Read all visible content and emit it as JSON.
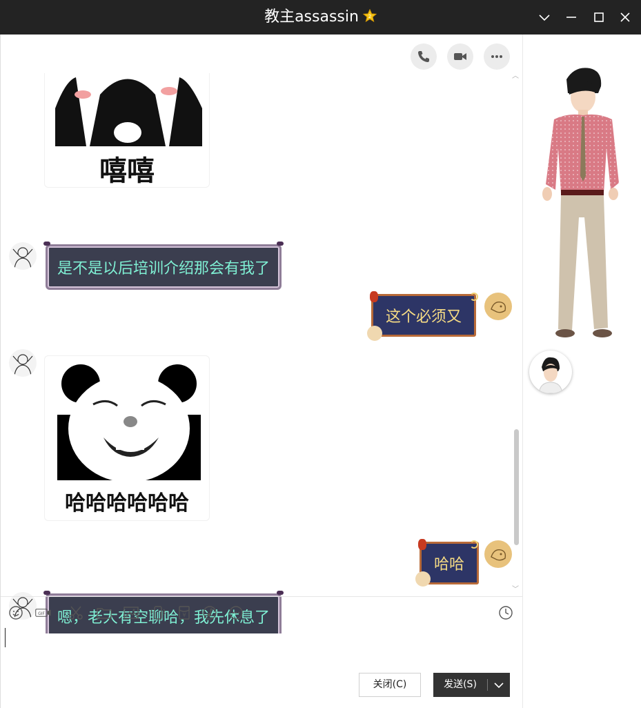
{
  "window": {
    "title": "教主assassin",
    "controls": [
      "chevron-down",
      "minimize",
      "maximize",
      "close"
    ]
  },
  "header_actions": [
    "phone",
    "video",
    "more"
  ],
  "messages": [
    {
      "type": "sticker",
      "side": "in",
      "caption": "嘻嘻"
    },
    {
      "type": "text",
      "side": "in",
      "text": "是不是以后培训介绍那会有我了"
    },
    {
      "type": "text",
      "side": "out",
      "text": "这个必须又"
    },
    {
      "type": "sticker",
      "side": "in",
      "caption": "哈哈哈哈哈哈"
    },
    {
      "type": "text",
      "side": "out",
      "text": "哈哈"
    },
    {
      "type": "text",
      "side": "in",
      "text": "嗯，老大有空聊哈，我先休息了"
    }
  ],
  "toolbar": [
    "emoji",
    "gif",
    "screenshot",
    "folder",
    "image",
    "vibrate",
    "red-packet",
    "music",
    "more",
    "history"
  ],
  "buttons": {
    "close_label": "关闭(C)",
    "send_label": "发送(S)"
  },
  "colors": {
    "titlebar": "#232323",
    "incoming_text": "#7ff0d4",
    "outgoing_text": "#f7dc84",
    "send_button": "#333333"
  }
}
